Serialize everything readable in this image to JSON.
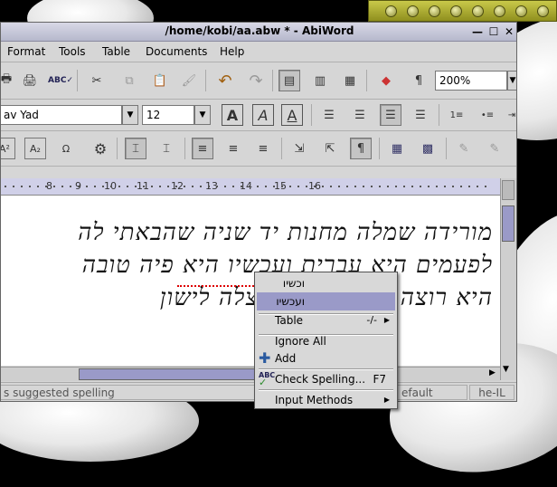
{
  "window": {
    "title": "/home/kobi/aa.abw * - AbiWord"
  },
  "menubar": [
    "Format",
    "Tools",
    "Table",
    "Documents",
    "Help"
  ],
  "toolbar": {
    "zoom_value": "200%",
    "pilcrow": "¶",
    "font_name": "av Yad",
    "font_size": "12"
  },
  "ruler": {
    "labels": [
      "8",
      "9",
      "10",
      "11",
      "12",
      "13",
      "14",
      "15",
      "16"
    ]
  },
  "document": {
    "lines": [
      "מורידה שמלה מחנות יד שניה שהבאתי לה",
      "לפעמים היא עברית ועכשיו היא פיה טובה",
      "היא רוצה שאני נשאר אצלה לישון"
    ],
    "misspelled_word": "ועכשיו"
  },
  "statusbar": {
    "message": "s suggested spelling",
    "mode": "efault",
    "language": "he-IL"
  },
  "context_menu": {
    "items": [
      {
        "label": "וכשיו",
        "highlighted": false
      },
      {
        "label": "ועכשיו",
        "highlighted": true
      },
      {
        "label": "Table",
        "shortcut": "-/-",
        "submenu": true
      },
      {
        "label": "Ignore All"
      },
      {
        "label": "Add",
        "icon": "plus-icon"
      },
      {
        "label": "Check Spelling...",
        "shortcut": "F7",
        "icon": "spellcheck-icon"
      },
      {
        "label": "Input Methods",
        "submenu": true
      }
    ]
  },
  "colors": {
    "highlight": "#9a9ac8",
    "ruler": "#d0d0e8",
    "player": "#b3b33a"
  }
}
